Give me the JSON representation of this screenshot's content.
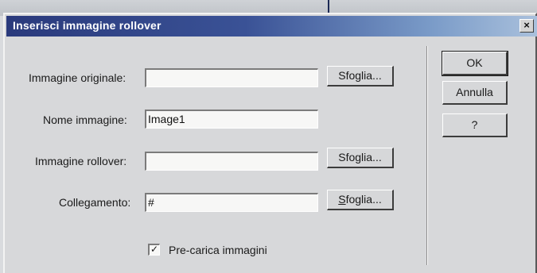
{
  "dialog": {
    "title": "Inserisci immagine rollover",
    "close_glyph": "×"
  },
  "form": {
    "original_image_label": "Immagine originale:",
    "original_image_value": "",
    "image_name_label": "Nome immagine:",
    "image_name_value": "Image1",
    "rollover_image_label": "Immagine rollover:",
    "rollover_image_value": "",
    "link_label": "Collegamento:",
    "link_value": "#",
    "browse_label": "Sfoglia...",
    "browse_link_first": "S",
    "browse_link_rest": "foglia...",
    "preload_label": "Pre-carica immagini",
    "preload_checked": true,
    "check_glyph": "✓"
  },
  "buttons": {
    "ok": "OK",
    "cancel": "Annulla",
    "help": "?"
  },
  "icons": {
    "close": "close-icon",
    "check": "check-icon"
  }
}
